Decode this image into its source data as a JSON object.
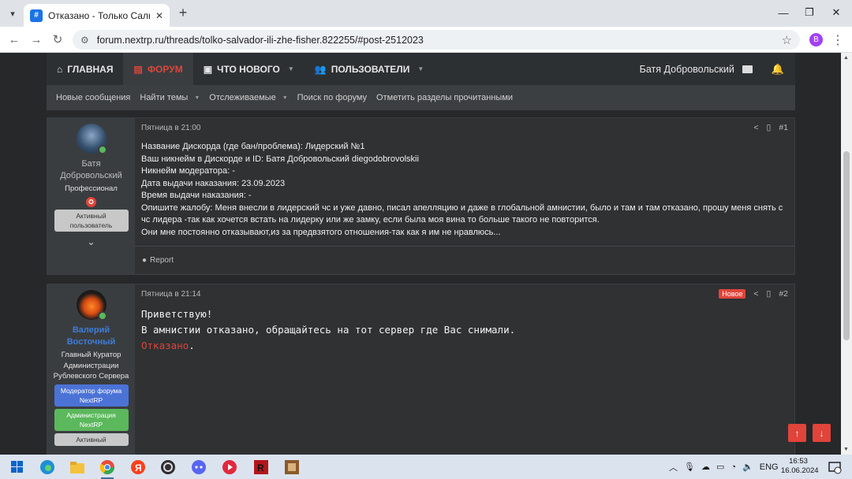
{
  "browser": {
    "tab_title": "Отказано - Только Сальвадор",
    "url": "forum.nextrp.ru/threads/tolko-salvador-ili-zhe-fisher.822255/#post-2512023",
    "profile_letter": "B"
  },
  "nav": {
    "items": [
      {
        "label": "Главная",
        "icon": "home-icon"
      },
      {
        "label": "Форум",
        "icon": "forum-icon"
      },
      {
        "label": "Что нового",
        "icon": "news-icon"
      },
      {
        "label": "Пользователи",
        "icon": "users-icon"
      }
    ],
    "user_name": "Батя Добровольский"
  },
  "subnav": {
    "items": [
      "Новые сообщения",
      "Найти темы",
      "Отслеживаемые",
      "Поиск по форуму",
      "Отметить разделы прочитанными"
    ]
  },
  "post1": {
    "author_first": "Батя",
    "author_last": "Добровольский",
    "author_title": "Профессионал",
    "banner": "Активный пользователь",
    "date": "Пятница в 21:00",
    "number": "#1",
    "lines": [
      "Название Дискорда (где бан/проблема): Лидерский №1",
      "Ваш никнейм в Дискорде и ID: Батя Добровольский diegodobrovolskii",
      "Никнейм модератора: -",
      "Дата выдачи наказания: 23.09.2023",
      "Время выдачи наказания: -",
      "Опишите жалобу: Меня внесли в лидерский чс и уже давно, писал апелляцию и даже в глобальной амнистии, было и там и там отказано, прошу меня снять с чс лидера -так как хочется встать на лидерку или же замку, если была моя вина то больше такого не повторится.",
      "Они мне постоянно отказывают,из за предвзятого отношения-так как я им не нравлюсь..."
    ],
    "footer_report": "Report"
  },
  "post2": {
    "author_first": "Валерий",
    "author_last": "Восточный",
    "author_title": "Главный Куратор Администрации Рублевского Сервера",
    "banner_mod": "Модератор форума NextRP",
    "banner_admin": "Администрация NextRP",
    "banner_active": "Активный",
    "date": "Пятница в 21:14",
    "new_badge": "Новое",
    "number": "#2",
    "line1": "Приветствую!",
    "line2": "В амнистии отказано, обращайтесь на тот сервер где Вас снимали.",
    "line3_red": "Отказано",
    "line3_tail": "."
  },
  "taskbar": {
    "lang": "ENG",
    "time": "16:53",
    "date": "16.06.2024",
    "notifications": "1"
  },
  "colors": {
    "accent": "#e0443a",
    "page_bg": "#262829",
    "staff_name": "#3d7ddb"
  }
}
